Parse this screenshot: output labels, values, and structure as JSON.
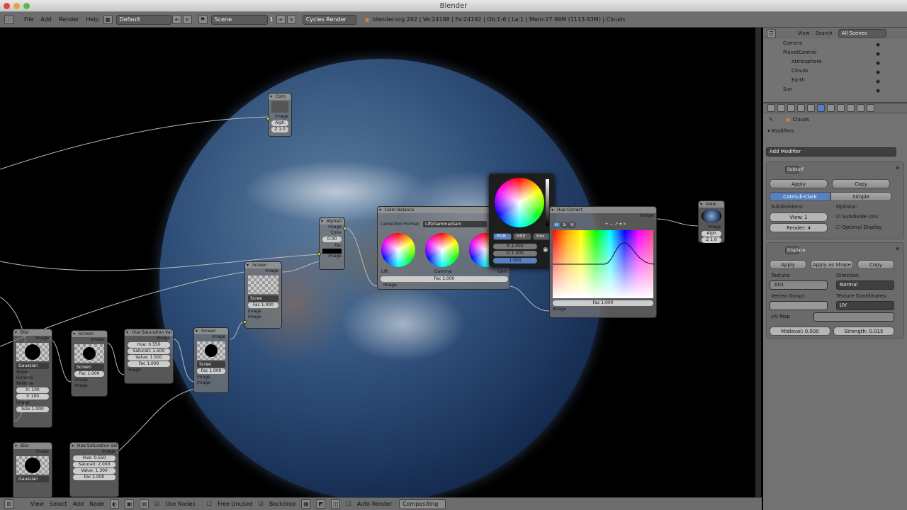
{
  "window": {
    "title": "Blender"
  },
  "topbar": {
    "menus": [
      "File",
      "Add",
      "Render",
      "Help"
    ],
    "screen": "Default",
    "scene": "Scene",
    "scene_num": "1",
    "engine": "Cycles Render",
    "info": "blender.org 262 | Ve:24198 | Fa:24192 | Ob:1-6 | La:1 | Mem:27.99M (1113.83M) | Clouds"
  },
  "nodes": {
    "comp": {
      "title": "Com",
      "rows": [
        "Image",
        "Alph",
        "Z 1.0"
      ]
    },
    "alphaover": {
      "title": "AlphaO",
      "rows": [
        "Image",
        "Conv",
        "0.00",
        "Fac",
        "Image",
        "Image"
      ]
    },
    "screen1": {
      "title": "Screen",
      "mode": "Scree",
      "fac": "Fac 1.000",
      "rows": [
        "Image",
        "Image",
        "Image"
      ]
    },
    "colorbal": {
      "title": "Color Balance",
      "format_label": "Correction Format:",
      "format": "Lift/Gamma/Gain",
      "labels": [
        "Lift:",
        "Gamma:",
        "Gain:"
      ],
      "fac": "Fac 1.000",
      "out": "Image"
    },
    "picker": {
      "tabs": [
        "RGB",
        "HSV",
        "Hex"
      ],
      "r": "R 1.000",
      "g": "G 1.000",
      "b": "1.000"
    },
    "huecorrect": {
      "title": "Hue Correct",
      "channels": [
        "H",
        "S",
        "V"
      ],
      "fac": "Fac 1.000",
      "in": "Image",
      "out": "Image"
    },
    "viewer": {
      "title": "View",
      "rows": [
        "Image",
        "Alph",
        "Z 1.0"
      ]
    },
    "blur1": {
      "title": "Blur",
      "mode": "Gaussian",
      "checks": [
        "Bokeh",
        "Gamma",
        "Relative"
      ],
      "x": "X: 100",
      "y": "Y: 100",
      "size": "Size 1.000",
      "out": "Image",
      "in": "Image"
    },
    "screen2": {
      "title": "Screen",
      "mode": "Screen",
      "fac": "Fac 1.000",
      "rows": [
        "Image",
        "Image",
        "Image"
      ]
    },
    "hsv1": {
      "title": "Hue Saturation Val",
      "hue": "Hue: 0.550",
      "sat": "Saturati: 1.500",
      "val": "Value: 1.500",
      "fac": "Fac 1.000",
      "rows": [
        "Image",
        "Image"
      ]
    },
    "screen3": {
      "title": "Screen",
      "mode": "Scree",
      "fac": "Fac 1.000",
      "rows": [
        "Image",
        "Image",
        "Image"
      ]
    },
    "blur2": {
      "title": "Blur",
      "mode": "Gaussian",
      "out": "Image"
    },
    "hsv2": {
      "title": "Hue Saturation Val",
      "hue": "Hue: 0.550",
      "sat": "Saturati: 2.000",
      "val": "Value: 1.300",
      "fac": "Fac 1.000",
      "out": "Image"
    }
  },
  "bottombar": {
    "menus": [
      "View",
      "Select",
      "Add",
      "Node"
    ],
    "use_nodes": "Use Nodes",
    "free_unused": "Free Unused",
    "backdrop": "Backdrop",
    "auto_render": "Auto Render",
    "tree": "Compositing"
  },
  "outliner": {
    "menus": [
      "View",
      "Search"
    ],
    "filter": "All Scenes",
    "items": [
      "Camera",
      "PlanetControl",
      "Atmosphere",
      "Clouds",
      "Earth",
      "Sun"
    ]
  },
  "props": {
    "context": "Clouds",
    "section": "Modifiers",
    "add": "Add Modifier",
    "mod1": {
      "name": "Subsurf",
      "apply": "Apply",
      "copy": "Copy",
      "types": [
        "Catmull-Clark",
        "Simple"
      ],
      "subdiv_label": "Subdivisions:",
      "options_label": "Options:",
      "view": "View: 1",
      "render": "Render: 4",
      "opt1": "Subdivide UVs",
      "opt2": "Optimal Display"
    },
    "mod2": {
      "name": "Displace",
      "apply": "Apply",
      "apply_shape": "Apply as Shape",
      "copy": "Copy",
      "texture_label": "Texture:",
      "texture": ".001",
      "direction_label": "Direction:",
      "direction": "Normal",
      "vgroup_label": "Vertex Group:",
      "coords_label": "Texture Coordinates:",
      "coords": "UV",
      "uvmap_label": "UV Map",
      "midlevel": "Midlevel: 0.500",
      "strength": "Strength: 0.015"
    }
  },
  "colors": {
    "accent": "#5680c2",
    "socket": "#e8e32a",
    "panel": "#727272"
  }
}
